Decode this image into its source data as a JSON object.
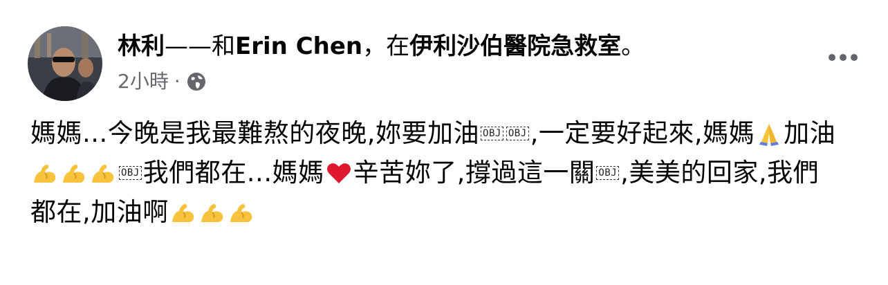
{
  "post": {
    "author": "林利",
    "connector": "——和",
    "tagged": "Erin Chen",
    "separator": "，在",
    "place": "伊利沙伯醫院急救室",
    "ending": "。",
    "time": "2小時",
    "dot": "·",
    "privacy_icon": "globe-icon",
    "more_icon": "more-options-icon"
  },
  "message": {
    "l1_a": "媽媽...今晚是我最難熬的夜晚,妳要加油",
    "obj": "OBJ",
    "l1_b": ",一定要好起來,媽媽",
    "l1_c": "加油",
    "l2_a": "我們都在...媽媽",
    "l2_b": "辛苦妳了,撐過這一關",
    "l2_c": ",美美的回家,我們",
    "l3_a": "都在,加油啊"
  },
  "colors": {
    "text": "#050505",
    "secondary": "#65676b",
    "heart": "#e0182d",
    "emoji_yellow": "#f7c23c"
  }
}
